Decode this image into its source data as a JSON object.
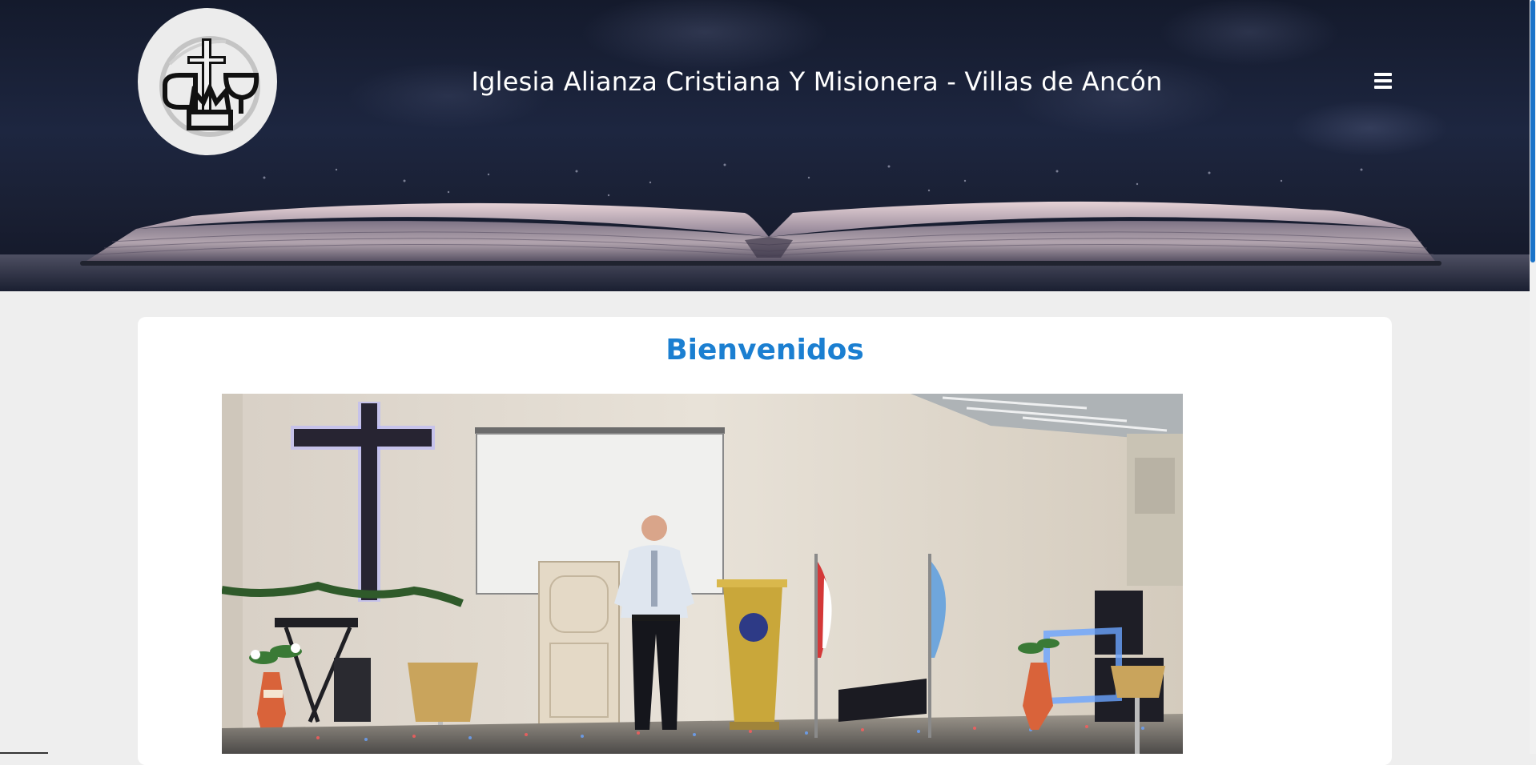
{
  "header": {
    "site_title": "Iglesia Alianza Cristiana Y Misionera - Villas de Ancón",
    "logo_icon": "church-logo-icon",
    "menu_icon": "hamburger-menu-icon"
  },
  "main": {
    "welcome_heading": "Bienvenidos",
    "photo_icon": "church-stage-photo"
  },
  "colors": {
    "accent": "#1b7fd1",
    "hero_background": "#1d2640",
    "page_background": "#eeeeee"
  }
}
